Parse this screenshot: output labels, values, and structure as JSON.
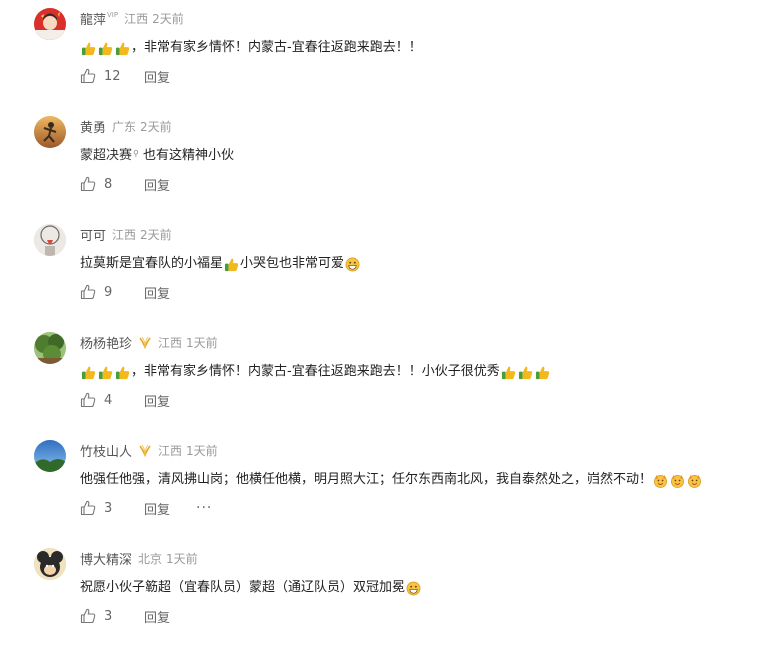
{
  "comments": [
    {
      "user": "龍萍",
      "vip": "VIP",
      "location": "江西",
      "time": "2天前",
      "pre_emojis": 3,
      "text": "，非常有家乡情怀！内蒙古-宜春往返跑来跑去！！",
      "likes": "12",
      "reply": "回复",
      "avatar_color": "#d9302b"
    },
    {
      "user": "黄勇",
      "location": "广东",
      "time": "2天前",
      "topic": "蒙超决赛",
      "text": " 也有这精神小伙",
      "likes": "8",
      "reply": "回复",
      "avatar_color": "#c9853a"
    },
    {
      "user": "可可",
      "location": "江西",
      "time": "2天前",
      "text_a": "拉莫斯是宜春队的小福星",
      "text_b": "小哭包也非常可爱",
      "likes": "9",
      "reply": "回复",
      "avatar_color": "#e9e4df"
    },
    {
      "user": "杨杨艳珍",
      "location": "江西",
      "time": "1天前",
      "pre_emojis": 3,
      "text": "，非常有家乡情怀！内蒙古-宜春往返跑来跑去！！小伙子很优秀",
      "likes": "4",
      "reply": "回复",
      "avatar_color": "#5f8f3c"
    },
    {
      "user": "竹枝山人",
      "location": "江西",
      "time": "1天前",
      "text": "他强任他强，清风拂山岗；他横任他横，明月照大江；任尔东西南北风，我自泰然处之，岿然不动！",
      "likes": "3",
      "reply": "回复",
      "more": "···",
      "avatar_color": "#3a74b8"
    },
    {
      "user": "博大精深",
      "location": "北京",
      "time": "1天前",
      "text": "祝愿小伙子簕超（宜春队员）蒙超（通辽队员）双冠加冕",
      "likes": "3",
      "reply": "回复",
      "avatar_color": "#d8c08a"
    }
  ],
  "icons": {
    "like": "thumbs-up-outline-icon",
    "strong": "thumbs-up-emoji",
    "smile": "grin-emoji",
    "cheer": "cheering-face-emoji",
    "badge": "gold-ring-badge-icon"
  }
}
